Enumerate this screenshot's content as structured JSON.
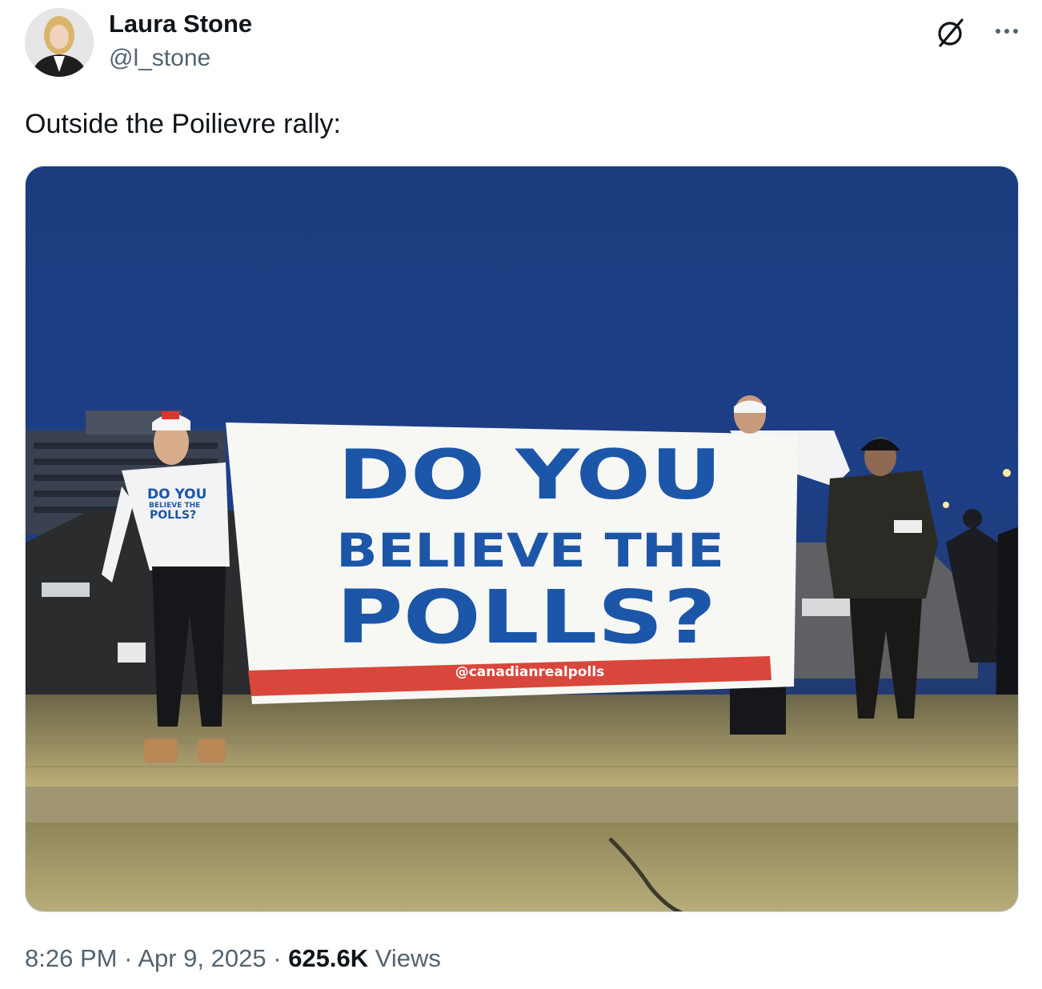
{
  "author": {
    "name": "Laura Stone",
    "handle": "@l_stone"
  },
  "tweet": {
    "text": "Outside the Poilievre rally:"
  },
  "photo": {
    "banner_line1": "DO YOU",
    "banner_line2": "BELIEVE THE",
    "banner_line3": "POLLS?",
    "banner_handle": "@canadianrealpolls",
    "shirt_line1": "DO YOU",
    "shirt_line2": "BELIEVE THE",
    "shirt_line3": "POLLS?"
  },
  "meta": {
    "time": "8:26 PM",
    "separator": "·",
    "date": "Apr 9, 2025",
    "views_count": "625.6K",
    "views_label": "Views"
  },
  "colors": {
    "sky": "#1b3e82",
    "banner_text": "#1c56a8",
    "banner_stripe": "#d9463b",
    "muted_text": "#536471"
  },
  "icons": [
    "grok-icon",
    "more-icon"
  ]
}
